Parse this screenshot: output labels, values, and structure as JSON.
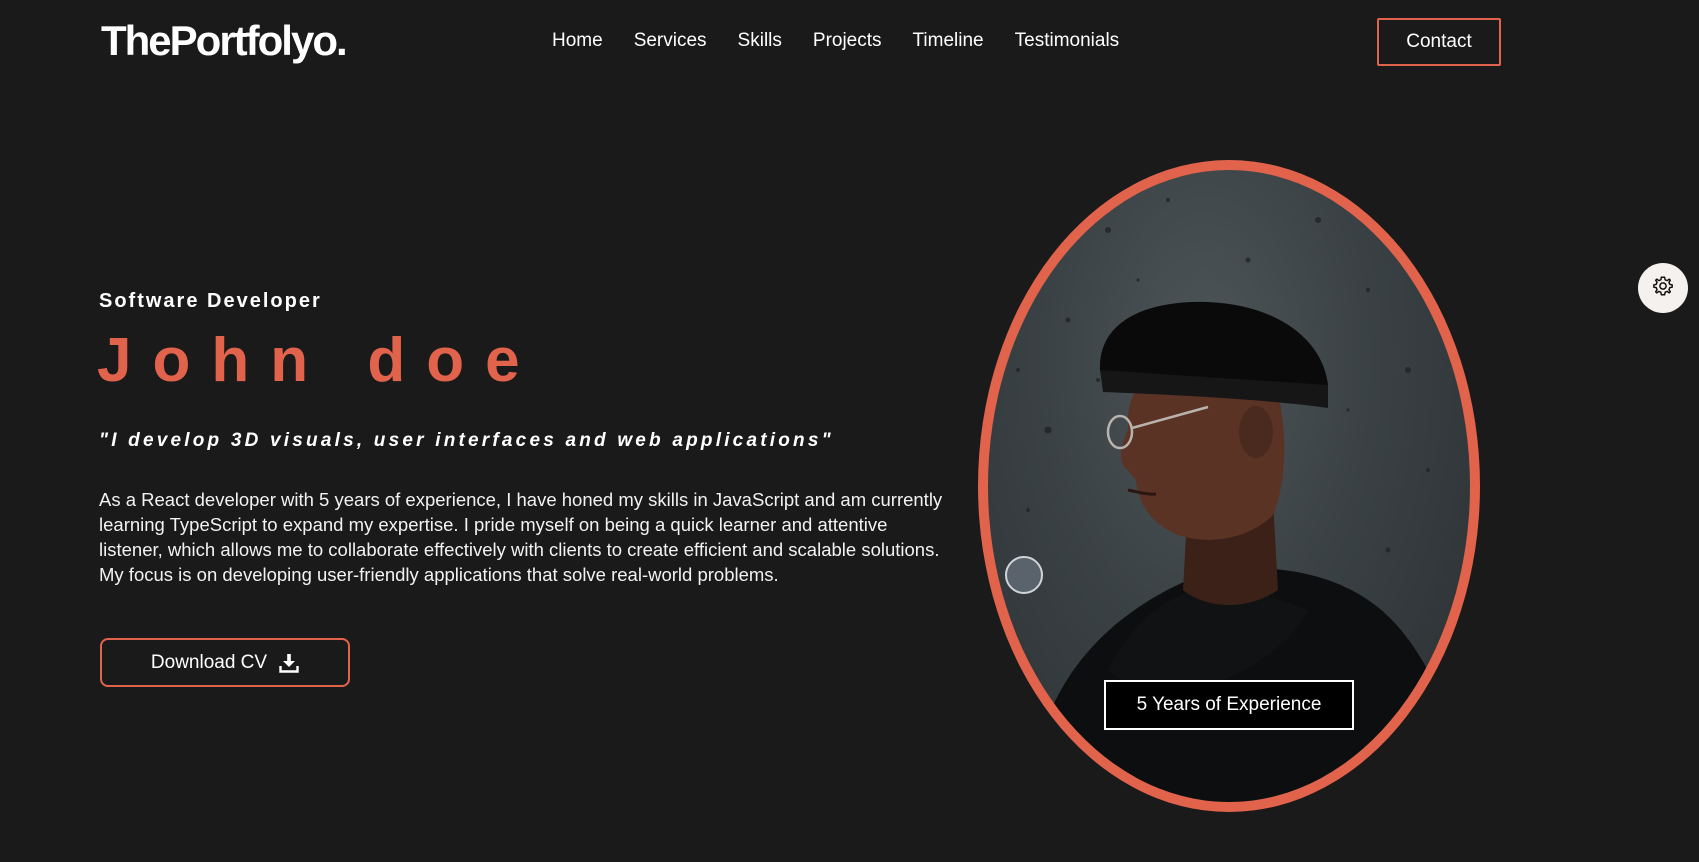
{
  "header": {
    "logo": "ThePortfolyo.",
    "nav": [
      "Home",
      "Services",
      "Skills",
      "Projects",
      "Timeline",
      "Testimonials"
    ],
    "contact_label": "Contact"
  },
  "hero": {
    "subtitle": "Software Developer",
    "name": "John doe",
    "tagline": "\"I develop 3D visuals, user interfaces and web applications\"",
    "bio": "As a React developer with 5 years of experience, I have honed my skills in JavaScript and am currently learning TypeScript to expand my expertise. I pride myself on being a quick learner and attentive listener, which allows me to collaborate effectively with clients to create efficient and scalable solutions. My focus is on developing user-friendly applications that solve real-world problems.",
    "download_label": "Download CV"
  },
  "profile": {
    "experience_badge": "5 Years of Experience"
  },
  "icons": {
    "download": "download-icon",
    "settings": "gear-icon"
  },
  "colors": {
    "accent": "#e2634c",
    "background": "#1b1a1b"
  }
}
